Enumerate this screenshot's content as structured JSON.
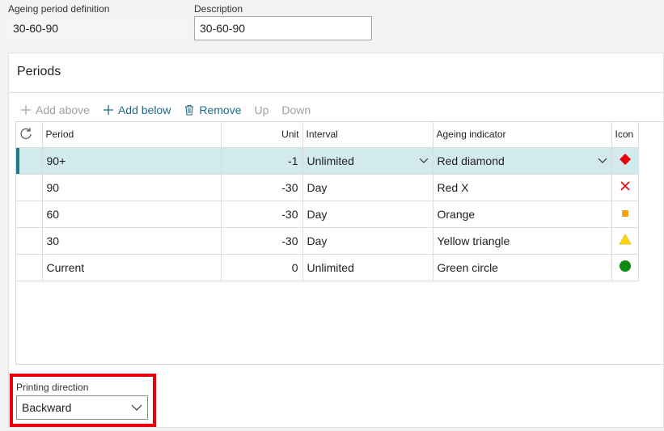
{
  "header": {
    "ageing_label": "Ageing period definition",
    "ageing_value": "30-60-90",
    "description_label": "Description",
    "description_value": "30-60-90"
  },
  "periods": {
    "title": "Periods",
    "toolbar": {
      "add_above": "Add above",
      "add_below": "Add below",
      "remove": "Remove",
      "up": "Up",
      "down": "Down"
    },
    "columns": {
      "period": "Period",
      "unit": "Unit",
      "interval": "Interval",
      "indicator": "Ageing indicator",
      "icon": "Icon"
    },
    "rows": [
      {
        "period": "90+",
        "unit": "-1",
        "interval": "Unlimited",
        "indicator": "Red diamond",
        "icon": "red-diamond-icon"
      },
      {
        "period": "90",
        "unit": "-30",
        "interval": "Day",
        "indicator": "Red X",
        "icon": "red-x-icon"
      },
      {
        "period": "60",
        "unit": "-30",
        "interval": "Day",
        "indicator": "Orange",
        "icon": "orange-square-icon"
      },
      {
        "period": "30",
        "unit": "-30",
        "interval": "Day",
        "indicator": "Yellow triangle",
        "icon": "yellow-triangle-icon"
      },
      {
        "period": "Current",
        "unit": "0",
        "interval": "Unlimited",
        "indicator": "Green circle",
        "icon": "green-circle-icon"
      }
    ]
  },
  "printing": {
    "label": "Printing direction",
    "value": "Backward"
  },
  "colors": {
    "accent": "#1f7a8c",
    "selected_row": "#d2e9ee",
    "highlight_border": "#e8000b",
    "red": "#e8000b",
    "orange": "#f0a30a",
    "yellow": "#ffd800",
    "green": "#0f8a0f"
  }
}
